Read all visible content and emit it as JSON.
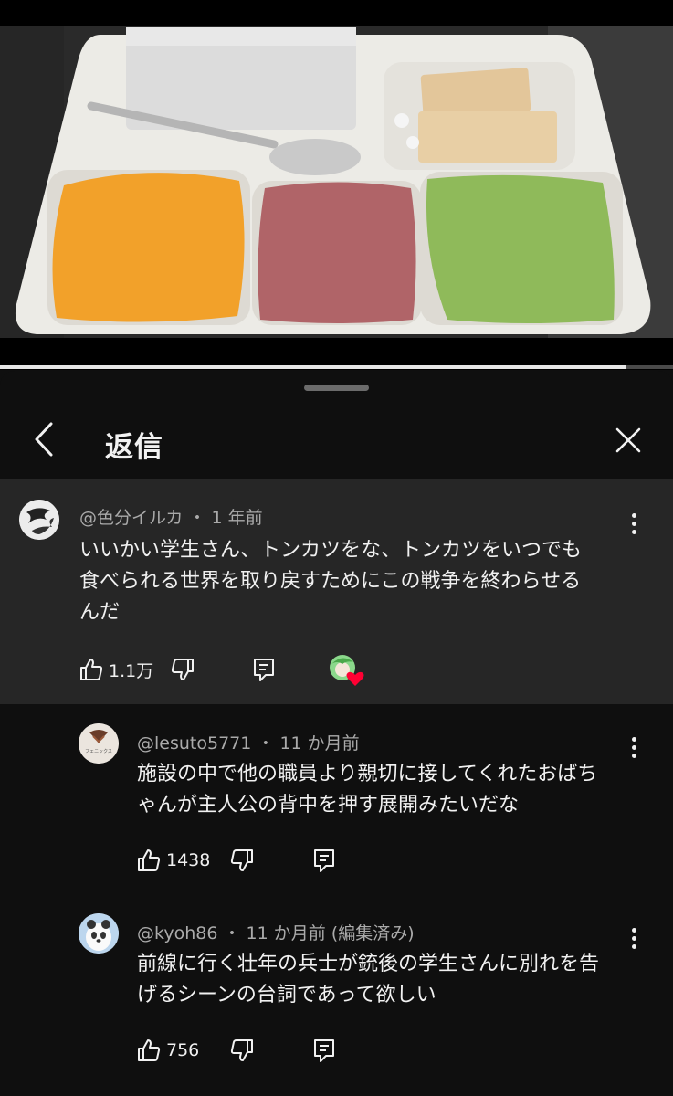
{
  "video": {
    "progress_fraction": 0.93
  },
  "sheet": {
    "title": "返信"
  },
  "parent_comment": {
    "handle": "@色分イルカ",
    "separator": "・",
    "time": "1 年前",
    "text_lines": [
      "いいかい学生さん、トンカツをな、トンカツをいつでも",
      "食べられる世界を取り戻すためにこの戦争を終わらせる",
      "んだ"
    ],
    "likes": "1.1万"
  },
  "replies": [
    {
      "handle": "@lesuto5771",
      "separator": "・",
      "time": "11 か月前",
      "avatar_text": "フェニックス",
      "text_lines": [
        "施設の中で他の職員より親切に接してくれたおばち",
        "ゃんが主人公の背中を押す展開みたいだな"
      ],
      "likes": "1438"
    },
    {
      "handle": "@kyoh86",
      "separator": "・",
      "time": "11 か月前 (編集済み)",
      "text_lines": [
        "前線に行く壮年の兵士が銃後の学生さんに別れを告",
        "げるシーンの台詞であって欲しい"
      ],
      "likes": "756"
    }
  ],
  "icons": {
    "back": "chevron-left-icon",
    "close": "close-icon",
    "like": "thumbs-up-icon",
    "dislike": "thumbs-down-icon",
    "reply": "reply-icon",
    "more": "more-vertical-icon",
    "creator_heart": "creator-heart-icon"
  },
  "colors": {
    "background": "#0f0f0f",
    "highlight": "#262626",
    "heart": "#ff0033",
    "text": "#f1f1f1",
    "meta": "#aaaaaa"
  }
}
